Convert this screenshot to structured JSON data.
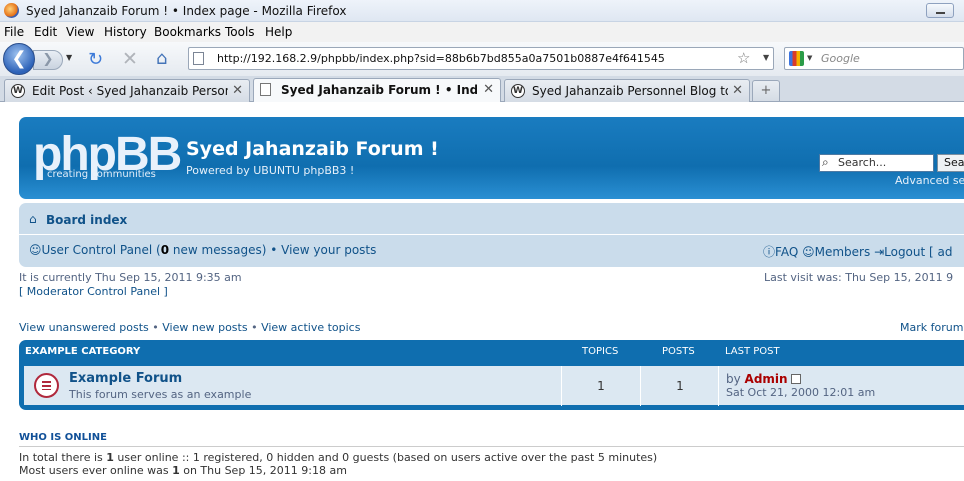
{
  "window": {
    "title": "Syed Jahanzaib Forum ! • Index page - Mozilla Firefox"
  },
  "menu": [
    "File",
    "Edit",
    "View",
    "History",
    "Bookmarks",
    "Tools",
    "Help"
  ],
  "address_bar": {
    "url": "http://192.168.2.9/phpbb/index.php?sid=88b6b7bd855a0a7501b0887e4f641545"
  },
  "search_bar": {
    "placeholder": "Google",
    "engine_icon": "google-icon"
  },
  "tabs": [
    {
      "label": "Edit Post ‹ Syed Jahanzaib Personne...",
      "icon": "wordpress-icon",
      "active": false
    },
    {
      "label": "Syed Jahanzaib Forum ! • Index p...",
      "icon": "page-icon",
      "active": true
    },
    {
      "label": "Syed Jahanzaib Personnel Blog to s...",
      "icon": "wordpress-icon",
      "active": false
    }
  ],
  "header": {
    "logo_text": "phpBB",
    "logo_sub": "creating   communities",
    "site_title": "Syed Jahanzaib Forum !",
    "site_desc": "Powered by UBUNTU phpBB3 !",
    "search_placeholder": "Search...",
    "search_button": "Sea",
    "advanced_search": "Advanced se"
  },
  "navbar": {
    "board_index": "Board index",
    "ucp_label": "User Control Panel (",
    "ucp_count": "0",
    "ucp_suffix": " new messages)",
    "bullet": " • ",
    "view_posts": "View your posts",
    "faq": "FAQ",
    "members": "Members",
    "logout": "Logout [ ad"
  },
  "info": {
    "current_time": "It is currently Thu Sep 15, 2011 9:35 am",
    "last_visit": "Last visit was: Thu Sep 15, 2011 9",
    "moderator_panel": "[ Moderator Control Panel ]",
    "view_unanswered": "View unanswered posts",
    "view_new": "View new posts",
    "view_active": "View active topics",
    "mark_forums": "Mark forum"
  },
  "forum_table": {
    "headers": {
      "category": "EXAMPLE CATEGORY",
      "topics": "TOPICS",
      "posts": "POSTS",
      "last_post": "LAST POST"
    },
    "rows": [
      {
        "name": "Example Forum",
        "description": "This forum serves as an example",
        "topics": "1",
        "posts": "1",
        "last_post_by_prefix": "by ",
        "last_post_by": "Admin",
        "last_post_date": "Sat Oct 21, 2000 12:01 am"
      }
    ]
  },
  "who_is_online": {
    "title": "WHO IS ONLINE",
    "line1_prefix": "In total there is ",
    "line1_count": "1",
    "line1_suffix": " user online :: 1 registered, 0 hidden and 0 guests (based on users active over the past 5 minutes)",
    "line2_prefix": "Most users ever online was ",
    "line2_count": "1",
    "line2_suffix": " on Thu Sep 15, 2011 9:18 am"
  },
  "colors": {
    "header_blue": "#0f6eaf",
    "nav_panel": "#cadceb",
    "link": "#105289",
    "admin": "#aa0000"
  }
}
